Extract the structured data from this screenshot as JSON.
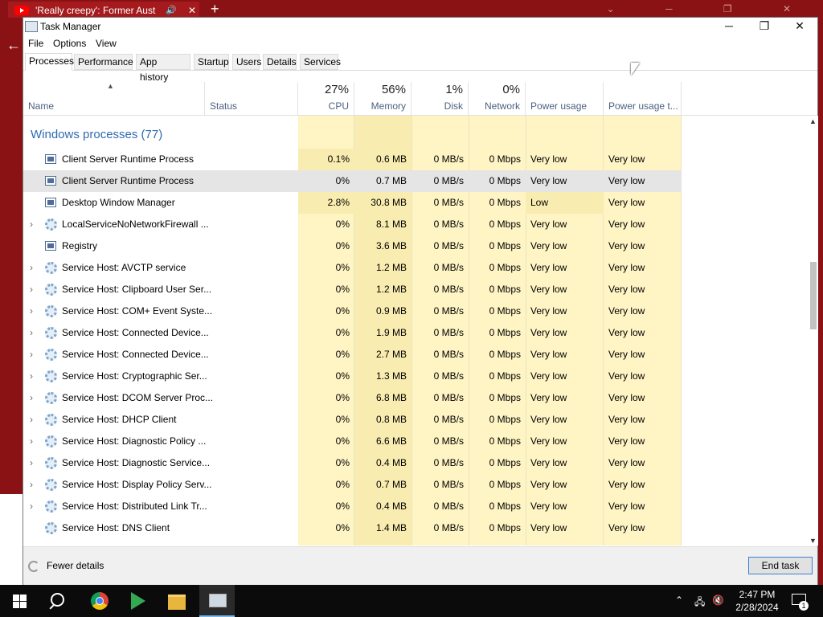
{
  "background": {
    "browser_tab_title": "'Really creepy': Former Austr",
    "new_tab": "+",
    "tab_close": "✕",
    "back": "←"
  },
  "window": {
    "title": "Task Manager",
    "minimize": "─",
    "maximize": "❐",
    "close": "✕"
  },
  "menu": [
    "File",
    "Options",
    "View"
  ],
  "tabs": [
    "Processes",
    "Performance",
    "App history",
    "Startup",
    "Users",
    "Details",
    "Services"
  ],
  "selected_tab": "Processes",
  "columns": {
    "name": "Name",
    "status": "Status",
    "cpu": {
      "pct": "27%",
      "label": "CPU"
    },
    "memory": {
      "pct": "56%",
      "label": "Memory"
    },
    "disk": {
      "pct": "1%",
      "label": "Disk"
    },
    "network": {
      "pct": "0%",
      "label": "Network"
    },
    "power": "Power usage",
    "power_trend": "Power usage t..."
  },
  "group_title": "Windows processes (77)",
  "rows": [
    {
      "name": "Client Server Runtime Process",
      "icon": "process-icon",
      "expandable": false,
      "cpu": "0.1%",
      "memory": "0.6 MB",
      "disk": "0 MB/s",
      "network": "0 Mbps",
      "power": "Very low",
      "power_trend": "Very low"
    },
    {
      "name": "Client Server Runtime Process",
      "icon": "process-icon",
      "expandable": false,
      "cpu": "0%",
      "memory": "0.7 MB",
      "disk": "0 MB/s",
      "network": "0 Mbps",
      "power": "Very low",
      "power_trend": "Very low",
      "selected": true
    },
    {
      "name": "Desktop Window Manager",
      "icon": "process-icon",
      "expandable": false,
      "cpu": "2.8%",
      "memory": "30.8 MB",
      "disk": "0 MB/s",
      "network": "0 Mbps",
      "power": "Low",
      "power_trend": "Very low"
    },
    {
      "name": "LocalServiceNoNetworkFirewall ...",
      "icon": "gear-icon",
      "expandable": true,
      "cpu": "0%",
      "memory": "8.1 MB",
      "disk": "0 MB/s",
      "network": "0 Mbps",
      "power": "Very low",
      "power_trend": "Very low"
    },
    {
      "name": "Registry",
      "icon": "process-icon",
      "expandable": false,
      "cpu": "0%",
      "memory": "3.6 MB",
      "disk": "0 MB/s",
      "network": "0 Mbps",
      "power": "Very low",
      "power_trend": "Very low"
    },
    {
      "name": "Service Host: AVCTP service",
      "icon": "gear-icon",
      "expandable": true,
      "cpu": "0%",
      "memory": "1.2 MB",
      "disk": "0 MB/s",
      "network": "0 Mbps",
      "power": "Very low",
      "power_trend": "Very low"
    },
    {
      "name": "Service Host: Clipboard User Ser...",
      "icon": "gear-icon",
      "expandable": true,
      "cpu": "0%",
      "memory": "1.2 MB",
      "disk": "0 MB/s",
      "network": "0 Mbps",
      "power": "Very low",
      "power_trend": "Very low"
    },
    {
      "name": "Service Host: COM+ Event Syste...",
      "icon": "gear-icon",
      "expandable": true,
      "cpu": "0%",
      "memory": "0.9 MB",
      "disk": "0 MB/s",
      "network": "0 Mbps",
      "power": "Very low",
      "power_trend": "Very low"
    },
    {
      "name": "Service Host: Connected Device...",
      "icon": "gear-icon",
      "expandable": true,
      "cpu": "0%",
      "memory": "1.9 MB",
      "disk": "0 MB/s",
      "network": "0 Mbps",
      "power": "Very low",
      "power_trend": "Very low"
    },
    {
      "name": "Service Host: Connected Device...",
      "icon": "gear-icon",
      "expandable": true,
      "cpu": "0%",
      "memory": "2.7 MB",
      "disk": "0 MB/s",
      "network": "0 Mbps",
      "power": "Very low",
      "power_trend": "Very low"
    },
    {
      "name": "Service Host: Cryptographic Ser...",
      "icon": "gear-icon",
      "expandable": true,
      "cpu": "0%",
      "memory": "1.3 MB",
      "disk": "0 MB/s",
      "network": "0 Mbps",
      "power": "Very low",
      "power_trend": "Very low"
    },
    {
      "name": "Service Host: DCOM Server Proc...",
      "icon": "gear-icon",
      "expandable": true,
      "cpu": "0%",
      "memory": "6.8 MB",
      "disk": "0 MB/s",
      "network": "0 Mbps",
      "power": "Very low",
      "power_trend": "Very low"
    },
    {
      "name": "Service Host: DHCP Client",
      "icon": "gear-icon",
      "expandable": true,
      "cpu": "0%",
      "memory": "0.8 MB",
      "disk": "0 MB/s",
      "network": "0 Mbps",
      "power": "Very low",
      "power_trend": "Very low"
    },
    {
      "name": "Service Host: Diagnostic Policy ...",
      "icon": "gear-icon",
      "expandable": true,
      "cpu": "0%",
      "memory": "6.6 MB",
      "disk": "0 MB/s",
      "network": "0 Mbps",
      "power": "Very low",
      "power_trend": "Very low"
    },
    {
      "name": "Service Host: Diagnostic Service...",
      "icon": "gear-icon",
      "expandable": true,
      "cpu": "0%",
      "memory": "0.4 MB",
      "disk": "0 MB/s",
      "network": "0 Mbps",
      "power": "Very low",
      "power_trend": "Very low"
    },
    {
      "name": "Service Host: Display Policy Serv...",
      "icon": "gear-icon",
      "expandable": true,
      "cpu": "0%",
      "memory": "0.7 MB",
      "disk": "0 MB/s",
      "network": "0 Mbps",
      "power": "Very low",
      "power_trend": "Very low"
    },
    {
      "name": "Service Host: Distributed Link Tr...",
      "icon": "gear-icon",
      "expandable": true,
      "cpu": "0%",
      "memory": "0.4 MB",
      "disk": "0 MB/s",
      "network": "0 Mbps",
      "power": "Very low",
      "power_trend": "Very low"
    },
    {
      "name": "Service Host: DNS Client",
      "icon": "gear-icon",
      "expandable": false,
      "cpu": "0%",
      "memory": "1.4 MB",
      "disk": "0 MB/s",
      "network": "0 Mbps",
      "power": "Very low",
      "power_trend": "Very low"
    }
  ],
  "footer": {
    "fewer_details": "Fewer details",
    "end_task": "End task"
  },
  "taskbar": {
    "time": "2:47 PM",
    "date": "2/28/2024",
    "notifications": "1",
    "apps": [
      "windows-start-icon",
      "search-icon",
      "chrome-icon",
      "play-store-icon",
      "file-explorer-icon",
      "task-manager-icon"
    ]
  },
  "colors": {
    "group_blue": "#2e6bb0",
    "heat_light": "#fff4c4",
    "heat_mid": "#f9ecb0",
    "browser_red": "#8a1214",
    "selected_row": "#e5e5e5"
  }
}
